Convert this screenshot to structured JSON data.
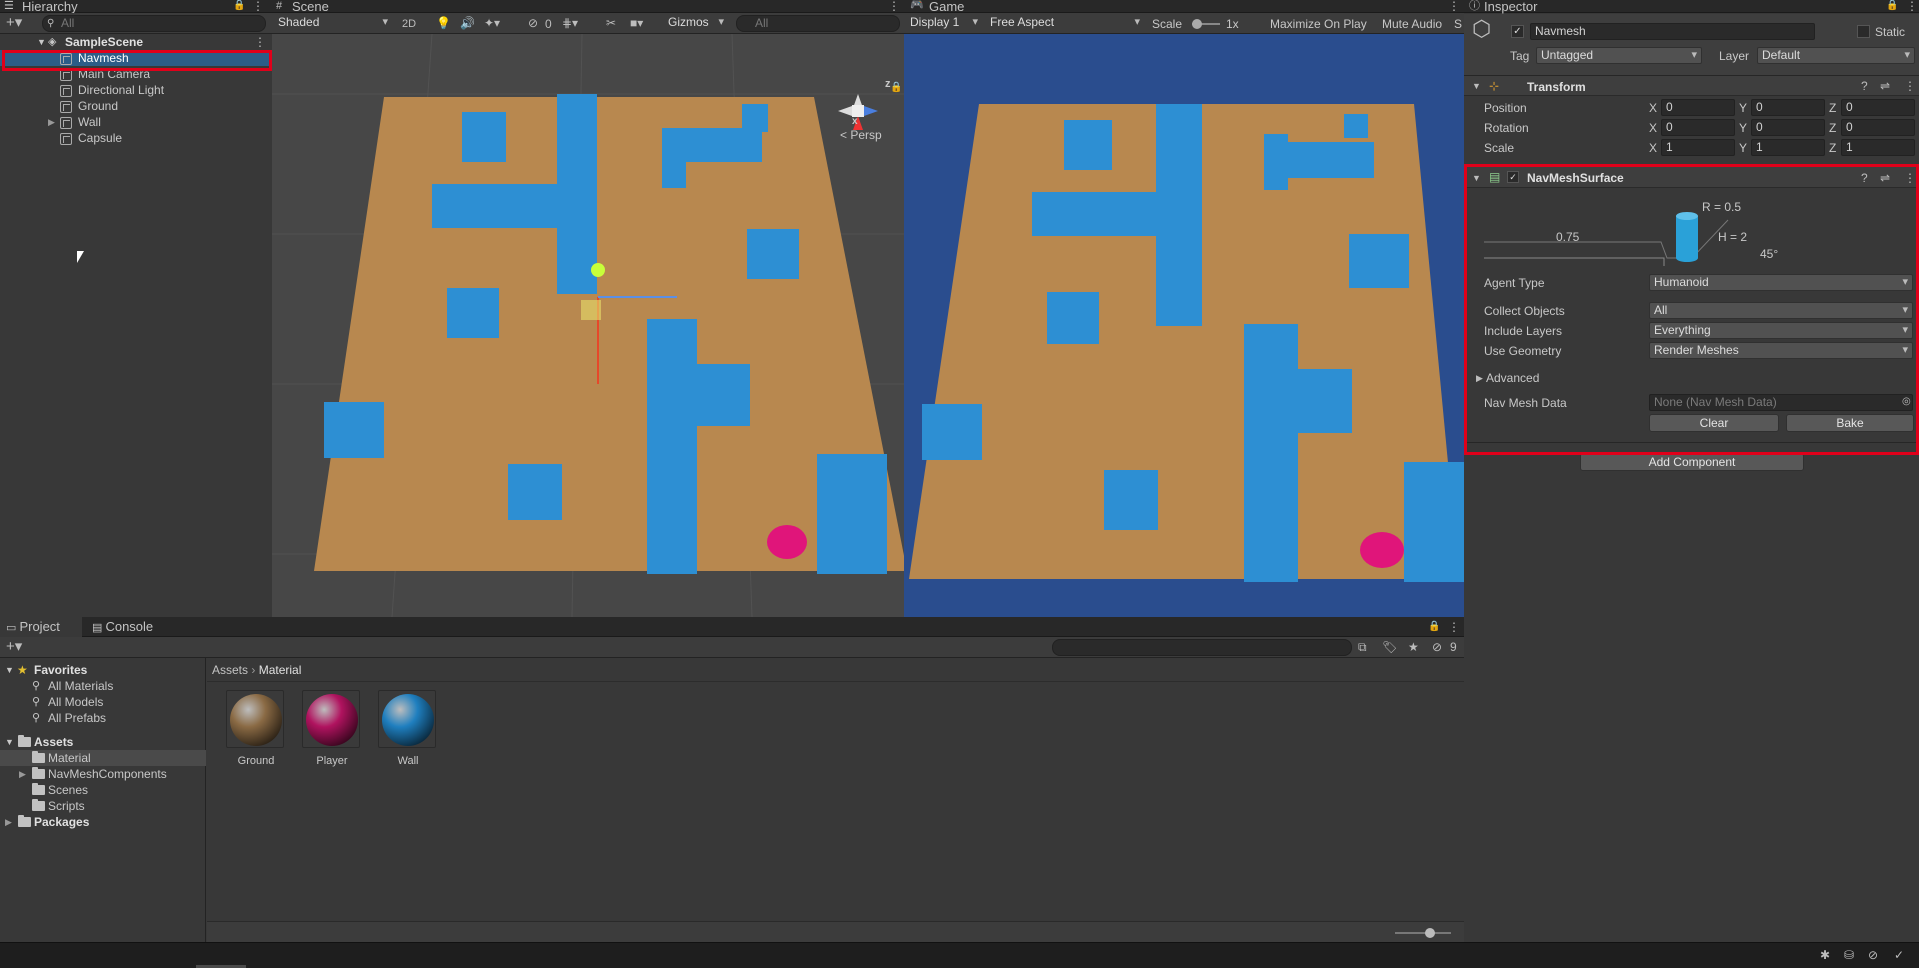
{
  "hierarchy": {
    "tab": "Hierarchy",
    "search_placeholder": "All",
    "scene": "SampleScene",
    "items": [
      "Navmesh",
      "Main Camera",
      "Directional Light",
      "Ground",
      "Wall",
      "Capsule"
    ]
  },
  "scene": {
    "tab": "Scene",
    "shading": "Shaded",
    "mode2d": "2D",
    "layer_count": "0",
    "gizmos": "Gizmos",
    "search_placeholder": "All",
    "persp": "< Persp",
    "axis_z": "z",
    "axis_x": "x"
  },
  "game": {
    "tab": "Game",
    "display": "Display 1",
    "aspect": "Free Aspect",
    "scale_label": "Scale",
    "scale_value": "1x",
    "maximize": "Maximize On Play",
    "mute": "Mute Audio",
    "s_cut": "S"
  },
  "inspector": {
    "tab": "Inspector",
    "object_name": "Navmesh",
    "static_label": "Static",
    "tag_label": "Tag",
    "tag_value": "Untagged",
    "layer_label": "Layer",
    "layer_value": "Default",
    "transform": {
      "title": "Transform",
      "rows": [
        {
          "label": "Position",
          "x": "0",
          "y": "0",
          "z": "0"
        },
        {
          "label": "Rotation",
          "x": "0",
          "y": "0",
          "z": "0"
        },
        {
          "label": "Scale",
          "x": "1",
          "y": "1",
          "z": "1"
        }
      ],
      "axis": [
        "X",
        "Y",
        "Z"
      ]
    },
    "navmesh": {
      "title": "NavMeshSurface",
      "radius": "R = 0.5",
      "height": "H = 2",
      "step": "0.75",
      "slope": "45°",
      "agent_type_label": "Agent Type",
      "agent_type": "Humanoid",
      "collect_label": "Collect Objects",
      "collect": "All",
      "include_label": "Include Layers",
      "include": "Everything",
      "geometry_label": "Use Geometry",
      "geometry": "Render Meshes",
      "advanced": "Advanced",
      "data_label": "Nav Mesh Data",
      "data_value": "None (Nav Mesh Data)",
      "clear": "Clear",
      "bake": "Bake"
    },
    "add_component": "Add Component"
  },
  "project": {
    "tab_project": "Project",
    "tab_console": "Console",
    "hidden_count": "9",
    "favorites": "Favorites",
    "fav_items": [
      "All Materials",
      "All Models",
      "All Prefabs"
    ],
    "assets": "Assets",
    "folders": [
      "Material",
      "NavMeshComponents",
      "Scenes",
      "Scripts"
    ],
    "packages": "Packages",
    "breadcrumb": [
      "Assets",
      "Material"
    ],
    "materials": [
      {
        "name": "Ground",
        "color": "#8a6a44"
      },
      {
        "name": "Player",
        "color": "#b0135f"
      },
      {
        "name": "Wall",
        "color": "#1f7fbf"
      }
    ]
  },
  "colors": {
    "wall": "#2c8fd3",
    "floor": "#b98c55",
    "sky": "#2a4d8e",
    "player": "#e0157a",
    "highlight": "#e0001a"
  }
}
